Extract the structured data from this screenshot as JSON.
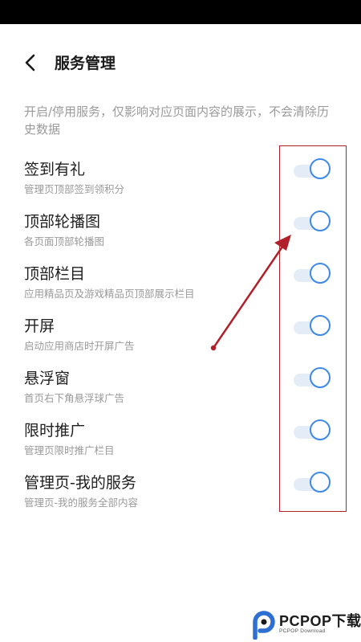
{
  "header": {
    "title": "服务管理"
  },
  "description": "开启/停用服务，仅影响对应页面内容的展示，不会清除历史数据",
  "items": [
    {
      "title": "签到有礼",
      "subtitle": "管理页顶部签到领积分",
      "enabled": true
    },
    {
      "title": "顶部轮播图",
      "subtitle": "各页面顶部轮播图",
      "enabled": true
    },
    {
      "title": "顶部栏目",
      "subtitle": "应用精品页及游戏精品页顶部展示栏目",
      "enabled": true
    },
    {
      "title": "开屏",
      "subtitle": "启动应用商店时开屏广告",
      "enabled": true
    },
    {
      "title": "悬浮窗",
      "subtitle": "首页右下角悬浮球广告",
      "enabled": true
    },
    {
      "title": "限时推广",
      "subtitle": "管理页限时推广栏目",
      "enabled": true
    },
    {
      "title": "管理页-我的服务",
      "subtitle": "管理页-我的服务全部内容",
      "enabled": true
    }
  ],
  "watermark": {
    "brand": "PCPOP下载",
    "sub": "PCPOP Download"
  },
  "colors": {
    "toggle_knob_border": "#3e8ae6",
    "toggle_track": "#e4ecf8",
    "annotation_red": "#b0202a",
    "status_bar": "#000000"
  }
}
